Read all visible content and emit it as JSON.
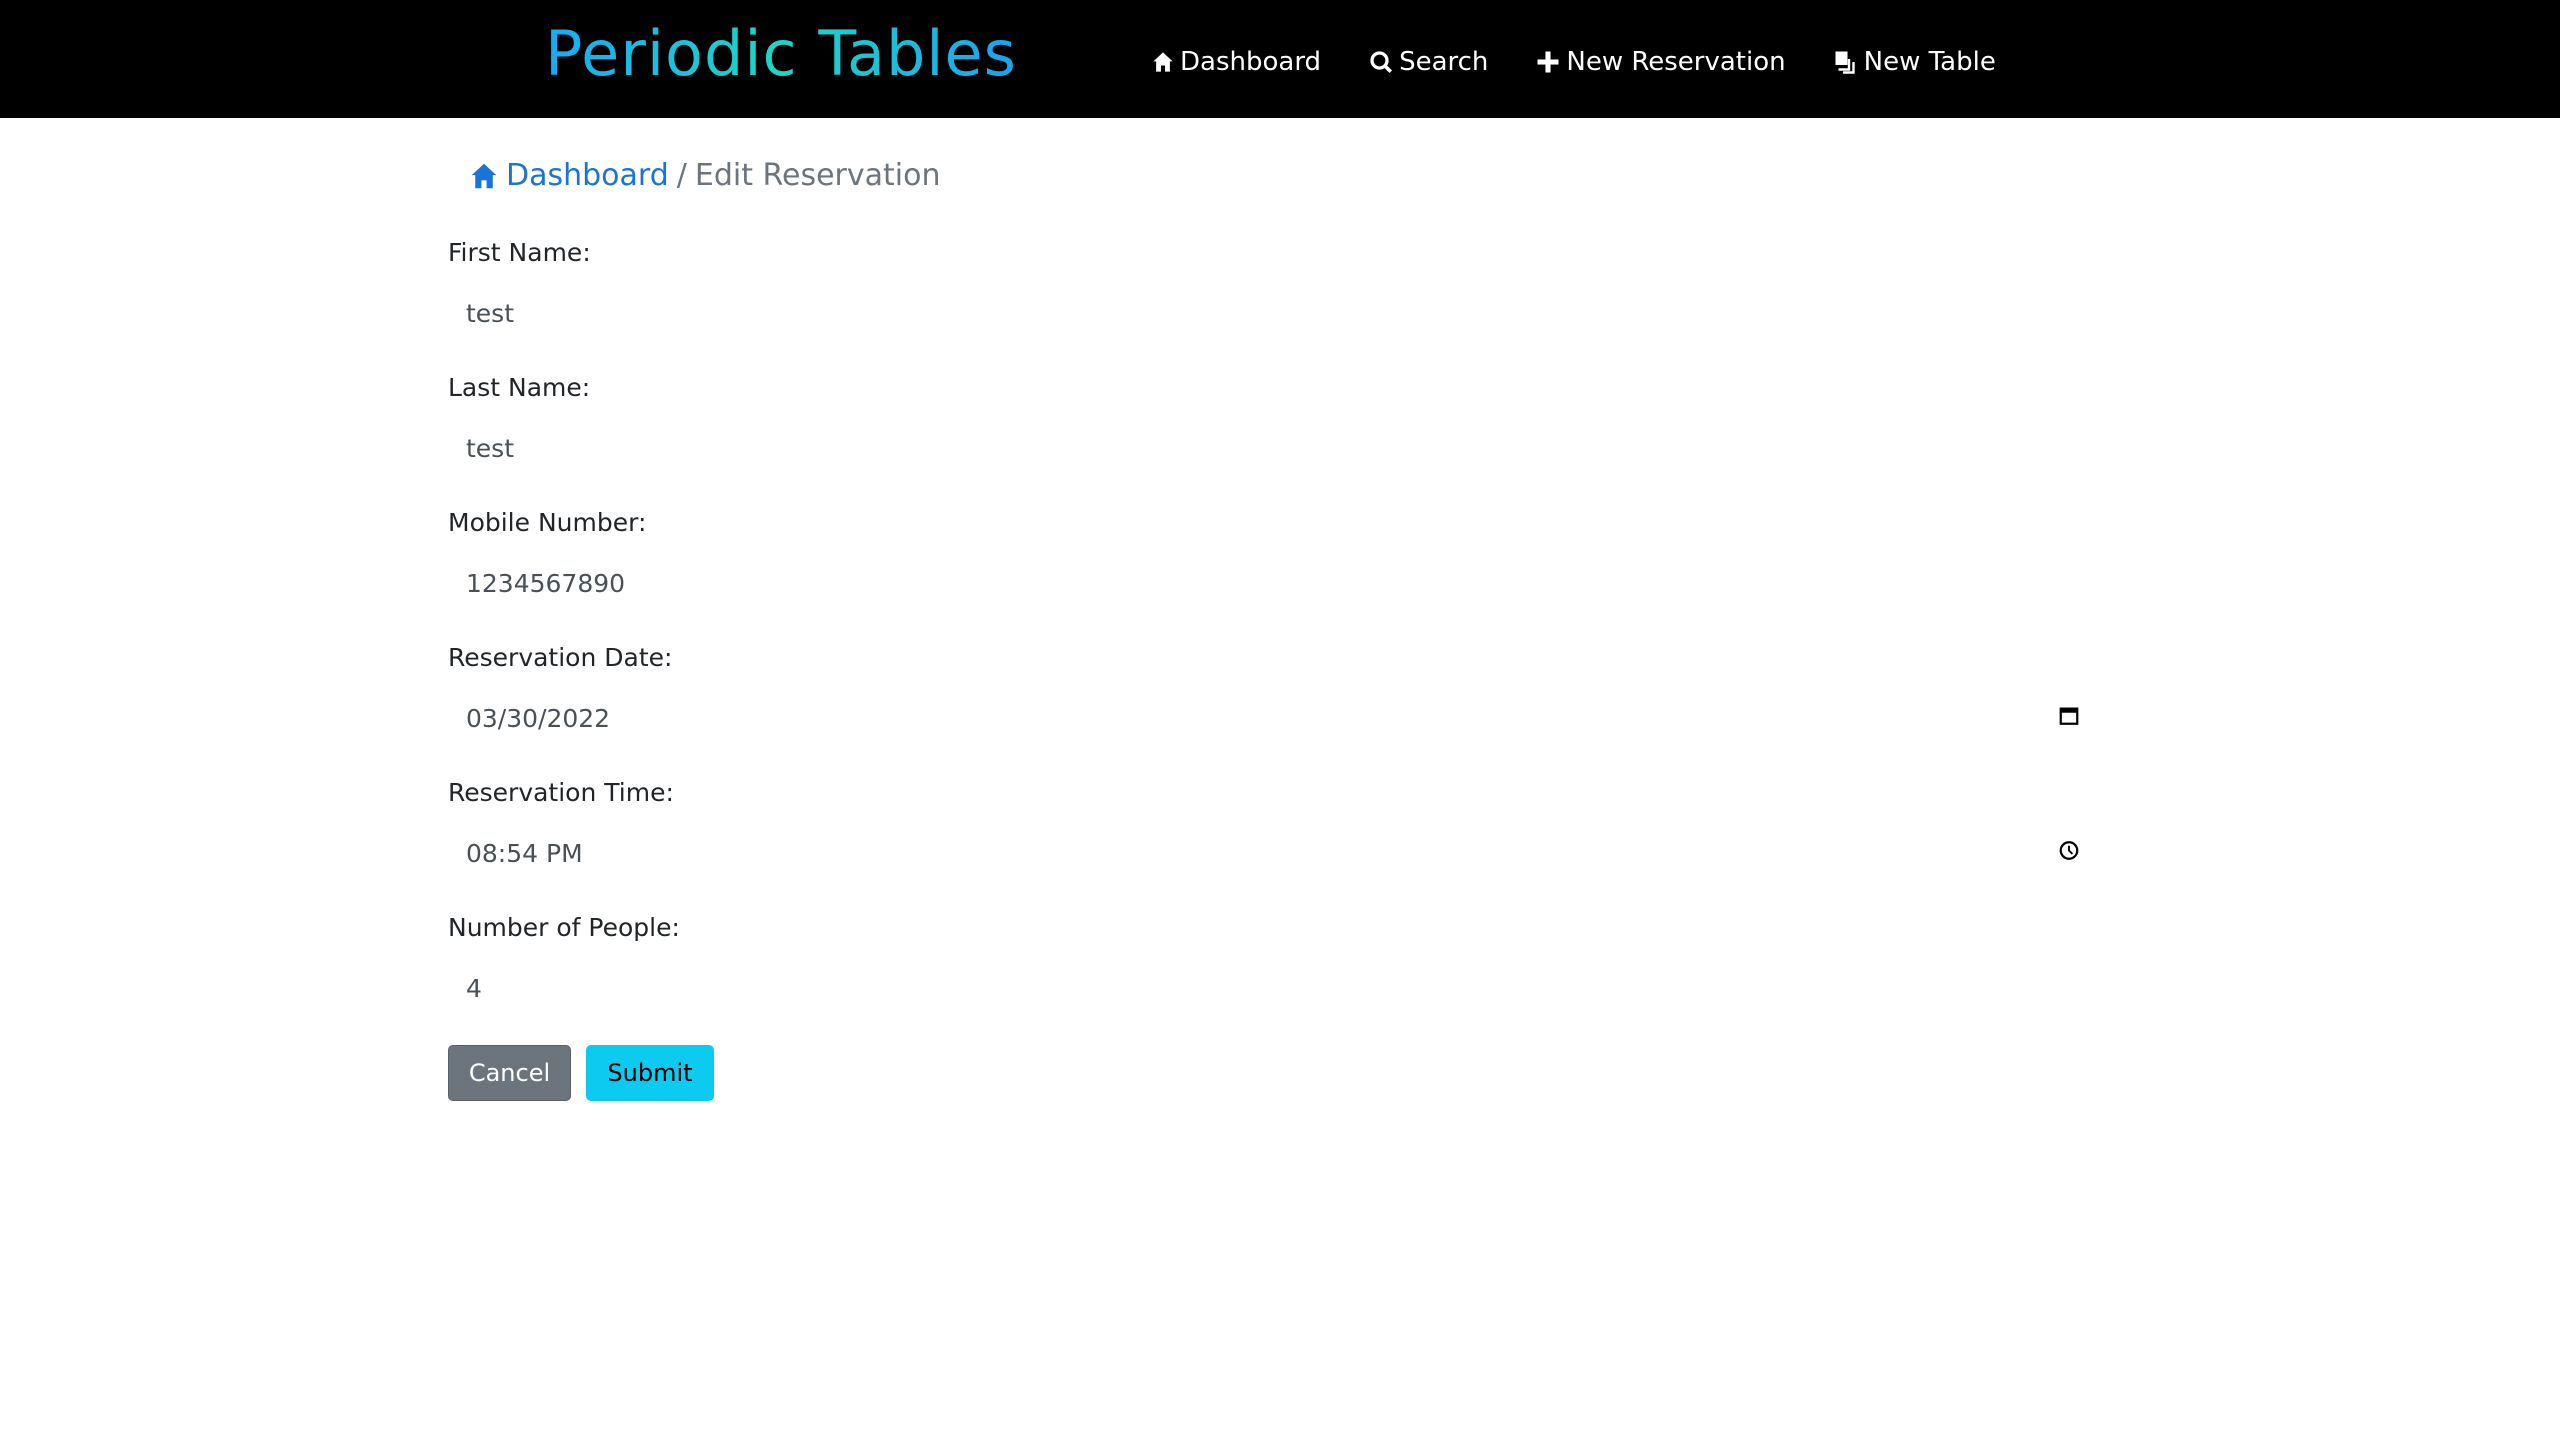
{
  "header": {
    "brand": "Periodic Tables",
    "nav": [
      {
        "label": "Dashboard",
        "icon": "home-icon"
      },
      {
        "label": "Search",
        "icon": "search-icon"
      },
      {
        "label": "New Reservation",
        "icon": "plus-icon"
      },
      {
        "label": "New Table",
        "icon": "table-icon"
      }
    ]
  },
  "breadcrumb": {
    "home_label": "Dashboard",
    "separator": "/",
    "current": "Edit Reservation"
  },
  "form": {
    "first_name": {
      "label": "First Name:",
      "value": "test"
    },
    "last_name": {
      "label": "Last Name:",
      "value": "test"
    },
    "mobile_number": {
      "label": "Mobile Number:",
      "value": "1234567890"
    },
    "reservation_date": {
      "label": "Reservation Date:",
      "value": "03/30/2022"
    },
    "reservation_time": {
      "label": "Reservation Time:",
      "value": "08:54 PM"
    },
    "people": {
      "label": "Number of People:",
      "value": "4"
    },
    "cancel_label": "Cancel",
    "submit_label": "Submit"
  },
  "colors": {
    "navbar_bg": "#000000",
    "brand_gradient_start": "#19a9f5",
    "brand_gradient_mid": "#1fd6c4",
    "link": "#1a73d9",
    "cancel_bg": "#6c757d",
    "submit_bg": "#0dcaf0"
  }
}
